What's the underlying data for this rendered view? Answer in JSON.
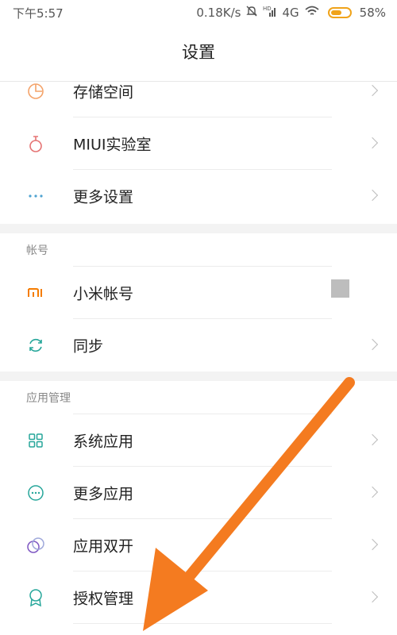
{
  "status_bar": {
    "time": "下午5:57",
    "speed": "0.18K/s",
    "network": "4G",
    "battery": "58%",
    "battery_level": 0.58,
    "icons": [
      "mute-bell-icon",
      "hd-signal-icon",
      "cell-signal-icon",
      "wifi-icon",
      "battery-icon"
    ]
  },
  "header": {
    "title": "设置"
  },
  "items": [
    {
      "label": "存储空间",
      "icon": "storage-pie-icon",
      "color": "#f4a36a"
    },
    {
      "label": "MIUI实验室",
      "icon": "flask-icon",
      "color": "#e57373"
    },
    {
      "label": "更多设置",
      "icon": "more-dots-icon",
      "color": "#4fa3d1"
    }
  ],
  "sections": {
    "account": {
      "header": "帐号",
      "items": [
        {
          "label": "小米帐号",
          "icon": "mi-logo-icon",
          "color": "#f57c00"
        },
        {
          "label": "同步",
          "icon": "sync-icon",
          "color": "#26a69a"
        }
      ]
    },
    "apps": {
      "header": "应用管理",
      "items": [
        {
          "label": "系统应用",
          "icon": "grid-apps-icon",
          "color": "#26a69a"
        },
        {
          "label": "更多应用",
          "icon": "more-circle-icon",
          "color": "#26a69a"
        },
        {
          "label": "应用双开",
          "icon": "dual-circles-icon",
          "color": "#7e57c2"
        },
        {
          "label": "授权管理",
          "icon": "badge-icon",
          "color": "#26a69a"
        }
      ]
    }
  },
  "accent_colors": {
    "battery": "#f0a31a",
    "arrow": "#f47b20"
  }
}
